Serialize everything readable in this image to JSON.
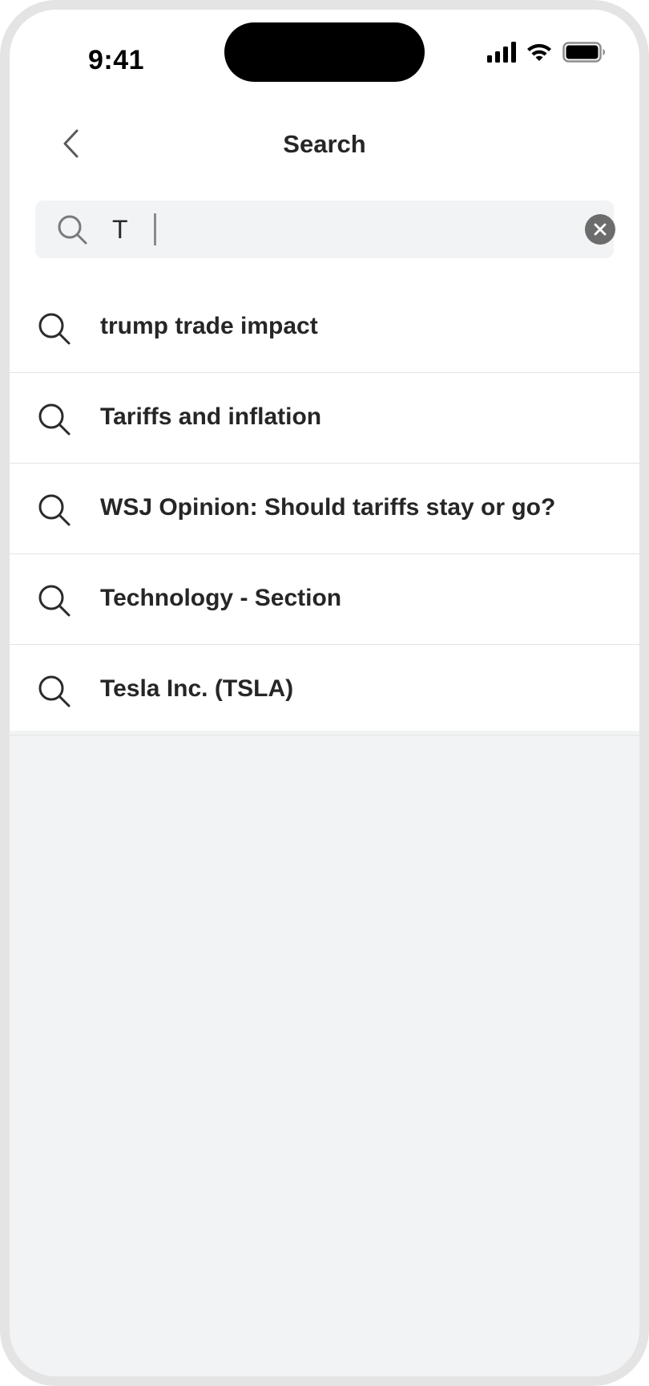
{
  "status_bar": {
    "time": "9:41"
  },
  "nav": {
    "title": "Search",
    "back_icon": "chevron-left-icon"
  },
  "search": {
    "value": "T",
    "icon": "search-icon",
    "clear_icon": "close-circle-icon"
  },
  "suggestions": [
    {
      "label": "trump trade impact"
    },
    {
      "label": "Tariffs and inflation"
    },
    {
      "label": "WSJ Opinion: Should tariffs stay or go?"
    },
    {
      "label": "Technology - Section"
    },
    {
      "label": "Tesla Inc. (TSLA)"
    }
  ],
  "colors": {
    "background": "#f2f3f5",
    "text": "#262626",
    "divider": "#e3e3e3",
    "clear_button": "#6c6c6c"
  }
}
